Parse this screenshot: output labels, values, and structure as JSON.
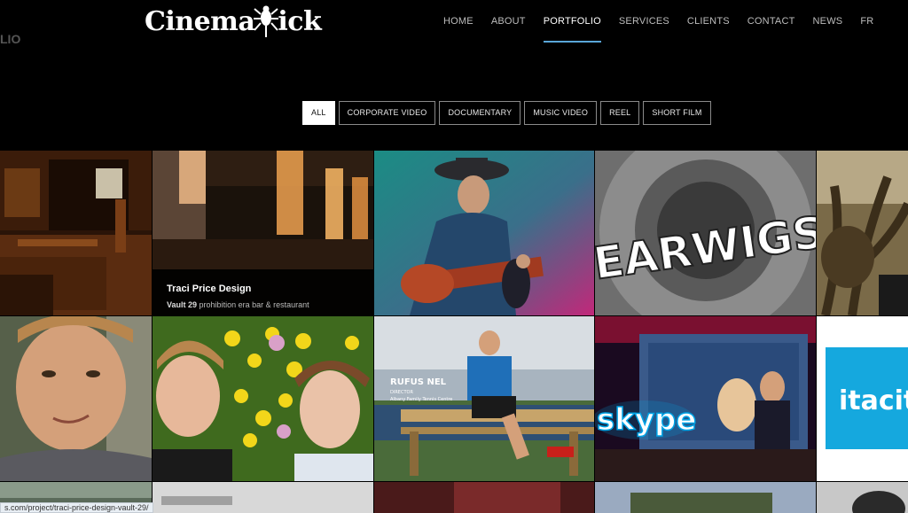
{
  "brand": {
    "logo_left": "Cinema",
    "logo_right": "ick",
    "ghost_text": "LIO"
  },
  "nav": [
    {
      "label": "HOME",
      "active": false
    },
    {
      "label": "ABOUT",
      "active": false
    },
    {
      "label": "PORTFOLIO",
      "active": true
    },
    {
      "label": "SERVICES",
      "active": false
    },
    {
      "label": "CLIENTS",
      "active": false
    },
    {
      "label": "CONTACT",
      "active": false
    },
    {
      "label": "NEWS",
      "active": false
    },
    {
      "label": "FR",
      "active": false
    }
  ],
  "filters": [
    {
      "label": "ALL",
      "active": true
    },
    {
      "label": "CORPORATE VIDEO",
      "active": false
    },
    {
      "label": "DOCUMENTARY",
      "active": false
    },
    {
      "label": "MUSIC VIDEO",
      "active": false
    },
    {
      "label": "REEL",
      "active": false
    },
    {
      "label": "SHORT FILM",
      "active": false
    }
  ],
  "portfolio": {
    "hover_title": "Traci Price Design",
    "hover_sub_bold": "Vault 29",
    "hover_sub_rest": "prohibition era bar & restaurant",
    "earwigs_text": "EARWIGS",
    "skype_text": "skype",
    "itacit_text": "itacit",
    "rufus_name": "RUFUS NEL",
    "rufus_role": "DIRECTOR",
    "rufus_org": "Albany Family Tennis Centre"
  },
  "status_url": "s.com/project/traci-price-design-vault-29/"
}
